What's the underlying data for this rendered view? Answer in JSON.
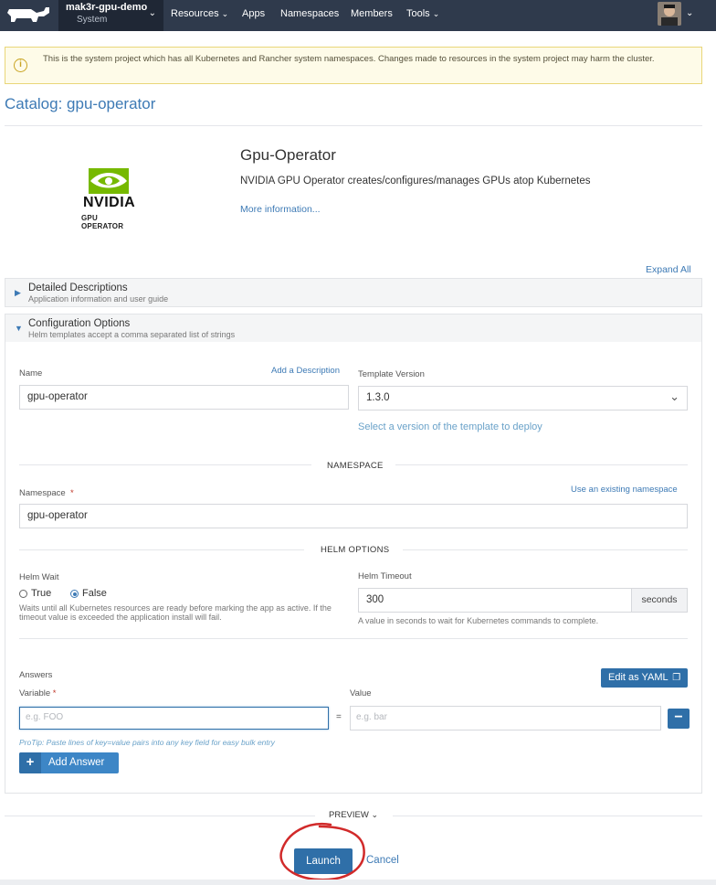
{
  "nav": {
    "cluster_name": "mak3r-gpu-demo",
    "project_name": "System",
    "items": [
      "Resources",
      "Apps",
      "Namespaces",
      "Members",
      "Tools"
    ]
  },
  "banner": {
    "text": "This is the system project which has all Kubernetes and Rancher system namespaces. Changes made to resources in the system project may harm the cluster."
  },
  "page_title": "Catalog: gpu-operator",
  "app": {
    "logo_brand": "NVIDIA",
    "logo_caption": "GPU OPERATOR",
    "name": "Gpu-Operator",
    "description": "NVIDIA GPU Operator creates/configures/manages GPUs atop Kubernetes",
    "more_info": "More information..."
  },
  "expand_all": "Expand All",
  "sections": {
    "detailed": {
      "title": "Detailed Descriptions",
      "subtitle": "Application information and user guide"
    },
    "config": {
      "title": "Configuration Options",
      "subtitle": "Helm templates accept a comma separated list of strings"
    }
  },
  "form": {
    "name_label": "Name",
    "add_description": "Add a Description",
    "name_value": "gpu-operator",
    "template_version_label": "Template Version",
    "template_version_value": "1.3.0",
    "template_version_help": "Select a version of the template to deploy",
    "namespace_header": "NAMESPACE",
    "namespace_label": "Namespace",
    "required_mark": "*",
    "use_existing": "Use an existing namespace",
    "namespace_value": "gpu-operator",
    "helm_header": "HELM OPTIONS",
    "helm_wait_label": "Helm Wait",
    "helm_wait_true": "True",
    "helm_wait_false": "False",
    "helm_wait_help": "Waits until all Kubernetes resources are ready before marking the app as active. If the timeout value is exceeded the application install will fail.",
    "helm_timeout_label": "Helm Timeout",
    "helm_timeout_value": "300",
    "helm_timeout_unit": "seconds",
    "helm_timeout_help": "A value in seconds to wait for Kubernetes commands to complete.",
    "answers_label": "Answers",
    "edit_yaml": "Edit as YAML",
    "variable_label": "Variable",
    "value_label": "Value",
    "variable_placeholder": "e.g. FOO",
    "value_placeholder": "e.g. bar",
    "equals": "=",
    "protip": "ProTip: Paste lines of key=value pairs into any key field for easy bulk entry",
    "add_answer": "Add Answer"
  },
  "preview": "PREVIEW",
  "actions": {
    "launch": "Launch",
    "cancel": "Cancel"
  },
  "colors": {
    "accent": "#3d7ab5",
    "nav_bg": "#2f3a4c",
    "annotation_circle": "#d12a2a"
  }
}
